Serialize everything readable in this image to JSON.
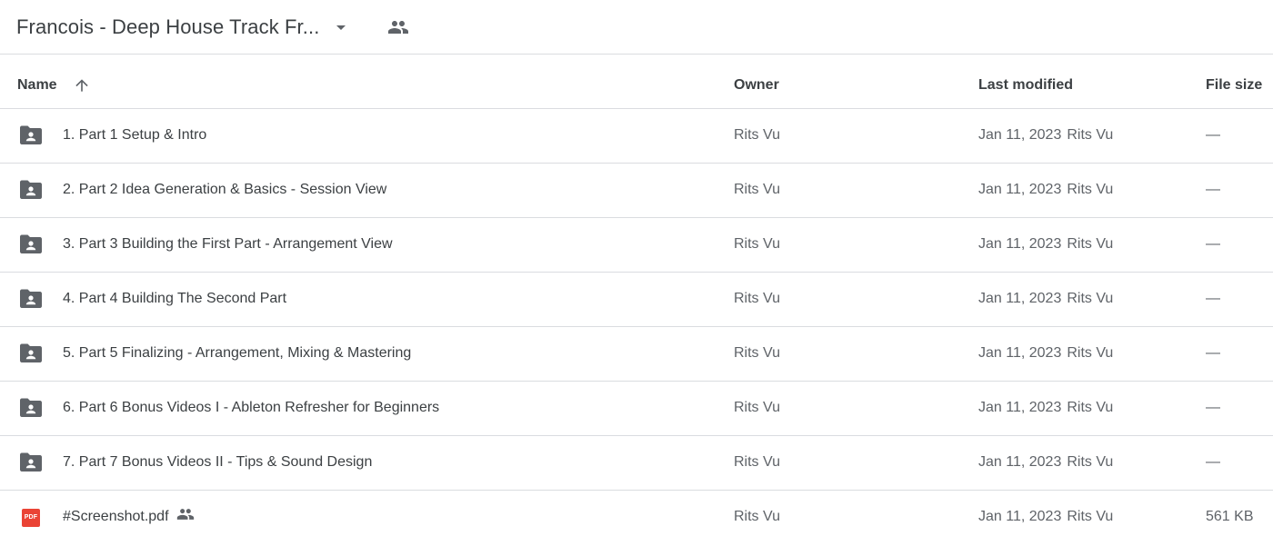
{
  "header": {
    "folder_title": "Francois - Deep House Track Fr...",
    "caret_icon": "arrow-drop-down-icon",
    "shared_icon": "people-icon"
  },
  "columns": {
    "name": "Name",
    "sort_icon": "arrow-upward-icon",
    "owner": "Owner",
    "last_modified": "Last modified",
    "file_size": "File size"
  },
  "rows": [
    {
      "icon": "shared-folder-icon",
      "name": "1. Part 1 Setup & Intro",
      "owner": "Rits Vu",
      "modified_date": "Jan 11, 2023",
      "modified_by": "Rits Vu",
      "size": "—"
    },
    {
      "icon": "shared-folder-icon",
      "name": "2. Part 2 Idea Generation & Basics - Session View",
      "owner": "Rits Vu",
      "modified_date": "Jan 11, 2023",
      "modified_by": "Rits Vu",
      "size": "—"
    },
    {
      "icon": "shared-folder-icon",
      "name": "3. Part 3 Building the First Part - Arrangement View",
      "owner": "Rits Vu",
      "modified_date": "Jan 11, 2023",
      "modified_by": "Rits Vu",
      "size": "—"
    },
    {
      "icon": "shared-folder-icon",
      "name": "4. Part 4 Building The Second Part",
      "owner": "Rits Vu",
      "modified_date": "Jan 11, 2023",
      "modified_by": "Rits Vu",
      "size": "—"
    },
    {
      "icon": "shared-folder-icon",
      "name": "5. Part 5 Finalizing - Arrangement, Mixing & Mastering",
      "owner": "Rits Vu",
      "modified_date": "Jan 11, 2023",
      "modified_by": "Rits Vu",
      "size": "—"
    },
    {
      "icon": "shared-folder-icon",
      "name": "6. Part 6 Bonus Videos I - Ableton Refresher for Beginners",
      "owner": "Rits Vu",
      "modified_date": "Jan 11, 2023",
      "modified_by": "Rits Vu",
      "size": "—"
    },
    {
      "icon": "shared-folder-icon",
      "name": "7. Part 7 Bonus Videos II - Tips & Sound Design",
      "owner": "Rits Vu",
      "modified_date": "Jan 11, 2023",
      "modified_by": "Rits Vu",
      "size": "—"
    },
    {
      "icon": "pdf-icon",
      "icon_text": "PDF",
      "name": "#Screenshot.pdf",
      "shared_icon": "people-icon",
      "owner": "Rits Vu",
      "modified_date": "Jan 11, 2023",
      "modified_by": "Rits Vu",
      "size": "561 KB"
    }
  ],
  "colors": {
    "text_primary": "#3c4043",
    "text_secondary": "#5f6368",
    "divider": "#dadce0",
    "icon_gray": "#5f6368",
    "pdf_red": "#ea4335"
  }
}
